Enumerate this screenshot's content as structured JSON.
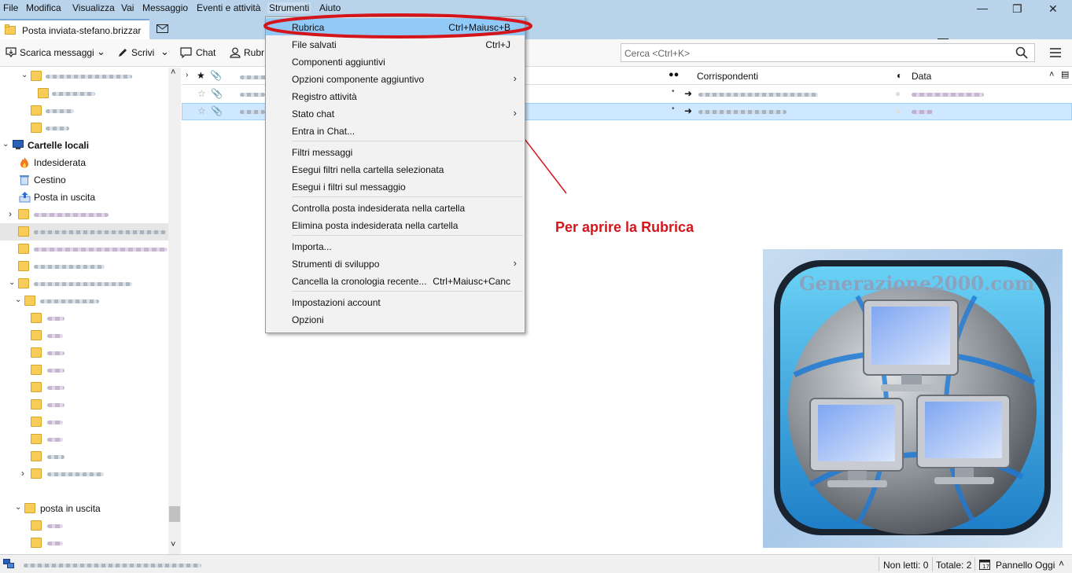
{
  "menubar": {
    "items": [
      "File",
      "Modifica",
      "Visualizza",
      "Vai",
      "Messaggio",
      "Eventi e attività",
      "Strumenti",
      "Aiuto"
    ],
    "active": "Strumenti"
  },
  "tabs": {
    "first_title": "Posta inviata-stefano.brizzar"
  },
  "toolbar": {
    "get_mail": "Scarica messaggi",
    "write": "Scrivi",
    "chat": "Chat",
    "address_book_partial": "Rubr",
    "search_placeholder": "Cerca <Ctrl+K>"
  },
  "folders": {
    "local_folders": "Cartelle locali",
    "junk": "Indesiderata",
    "trash": "Cestino",
    "outbox": "Posta in uscita",
    "outbox_sub": "posta in uscita"
  },
  "thread_header": {
    "correspondents": "Corrispondenti",
    "date": "Data"
  },
  "tools_menu": {
    "groups": [
      [
        {
          "label": "Rubrica",
          "shortcut": "Ctrl+Maiusc+B",
          "highlight": true
        },
        {
          "label": "File salvati",
          "shortcut": "Ctrl+J"
        },
        {
          "label": "Componenti aggiuntivi"
        },
        {
          "label": "Opzioni componente aggiuntivo",
          "submenu": true
        },
        {
          "label": "Registro attività"
        },
        {
          "label": "Stato chat",
          "submenu": true
        },
        {
          "label": "Entra in Chat..."
        }
      ],
      [
        {
          "label": "Filtri messaggi"
        },
        {
          "label": "Esegui filtri nella cartella selezionata"
        },
        {
          "label": "Esegui i filtri sul messaggio"
        }
      ],
      [
        {
          "label": "Controlla posta indesiderata nella cartella"
        },
        {
          "label": "Elimina posta indesiderata nella cartella"
        }
      ],
      [
        {
          "label": "Importa..."
        },
        {
          "label": "Strumenti di sviluppo",
          "submenu": true
        },
        {
          "label": "Cancella la cronologia recente...",
          "shortcut": "Ctrl+Maiusc+Canc"
        }
      ],
      [
        {
          "label": "Impostazioni account"
        },
        {
          "label": "Opzioni"
        }
      ]
    ]
  },
  "annotation": {
    "text": "Per aprire la Rubrica",
    "color": "#d4161c"
  },
  "logo": {
    "text": "Generazione2000.com"
  },
  "statusbar": {
    "unread": "Non letti: 0",
    "total": "Totale: 2",
    "today_pane": "Pannello Oggi"
  },
  "colors": {
    "menubar_bg": "#b8d3ea",
    "menu_highlight": "#91c9f7",
    "selection": "#cde8ff"
  }
}
